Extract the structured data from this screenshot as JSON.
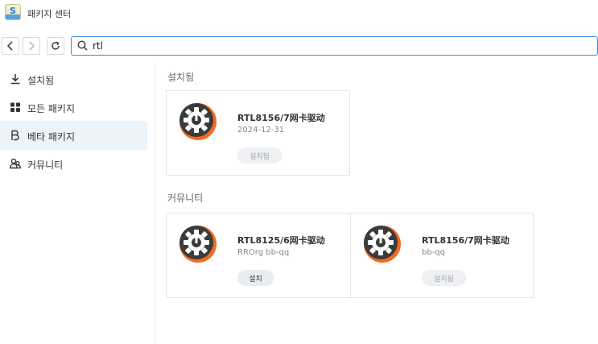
{
  "window": {
    "title": "패키지 센터"
  },
  "search": {
    "value": "rtl"
  },
  "sidebar": {
    "items": [
      {
        "label": "설치됨",
        "icon": "download-icon"
      },
      {
        "label": "모든 패키지",
        "icon": "grid-icon"
      },
      {
        "label": "베타 패키지",
        "icon": "beta-icon"
      },
      {
        "label": "커뮤니티",
        "icon": "community-icon"
      }
    ],
    "active_index": 2
  },
  "installed": {
    "title": "설치됨",
    "cards": [
      {
        "name": "RTL8156/7网卡驱动",
        "sub": "2024-12-31",
        "button": "설치됨"
      }
    ]
  },
  "community": {
    "title": "커뮤니티",
    "cards": [
      {
        "name": "RTL8125/6网卡驱动",
        "sub": "RROrg bb-qq",
        "button": "설치"
      },
      {
        "name": "RTL8156/7网卡驱动",
        "sub": "bb-qq",
        "button": "설치됨"
      }
    ]
  },
  "colors": {
    "accent": "#3a8be0",
    "sidebar_active": "#edf3fa",
    "pkg_icon_dark": "#3b3b3b",
    "pkg_icon_orange": "#f26b21"
  }
}
